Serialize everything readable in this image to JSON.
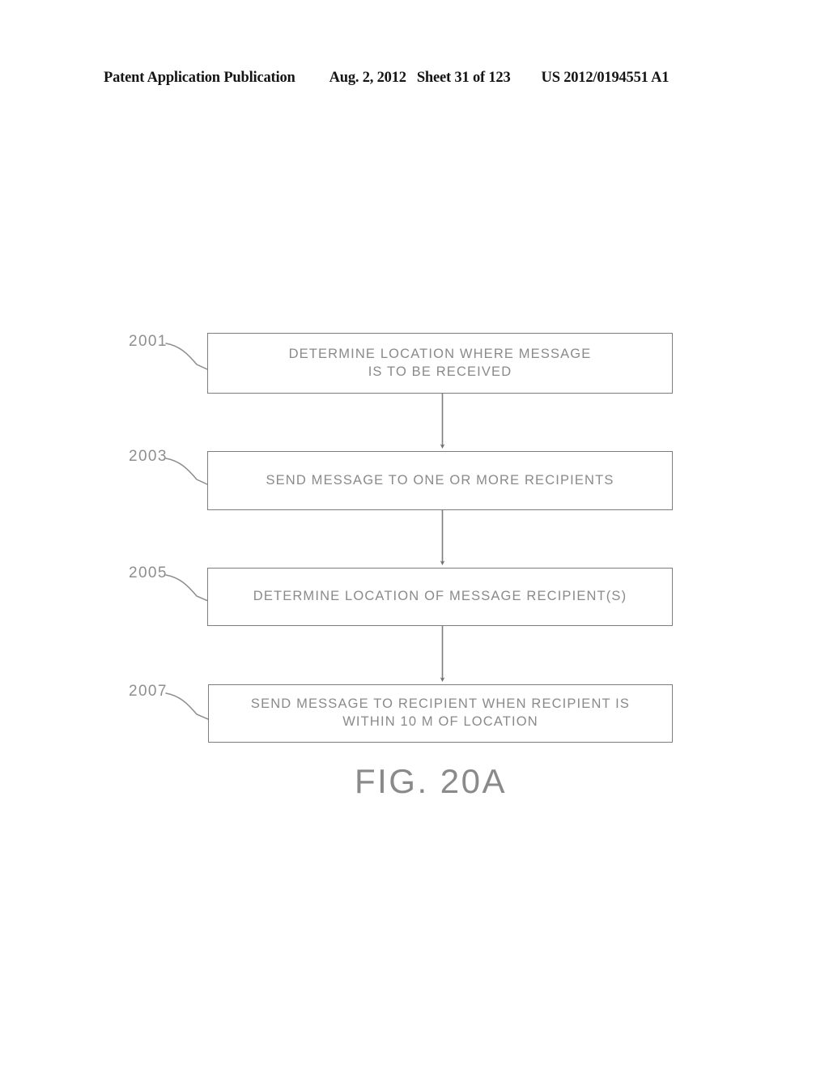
{
  "header": {
    "publication": "Patent Application Publication",
    "date": "Aug. 2, 2012",
    "sheet": "Sheet 31 of 123",
    "doc_number": "US 2012/0194551 A1"
  },
  "figure": {
    "caption": "FIG. 20A",
    "line_color": "#7d7d7d",
    "text_color": "#8a8a8a",
    "steps": [
      {
        "ref": "2001",
        "text": "DETERMINE LOCATION WHERE MESSAGE IS TO BE RECEIVED",
        "line1": "DETERMINE LOCATION WHERE MESSAGE",
        "line2": "IS TO BE RECEIVED"
      },
      {
        "ref": "2003",
        "text": "SEND MESSAGE TO ONE OR MORE RECIPIENTS",
        "line1": "SEND MESSAGE TO ONE OR MORE RECIPIENTS",
        "line2": ""
      },
      {
        "ref": "2005",
        "text": "DETERMINE LOCATION OF MESSAGE RECIPIENT(S)",
        "line1": "DETERMINE LOCATION OF MESSAGE RECIPIENT(S)",
        "line2": ""
      },
      {
        "ref": "2007",
        "text": "SEND MESSAGE TO RECIPIENT WHEN RECIPIENT IS WITHIN 10 M OF LOCATION",
        "line1": "SEND MESSAGE TO RECIPIENT WHEN RECIPIENT IS",
        "line2": "WITHIN 10 M OF LOCATION"
      }
    ]
  }
}
